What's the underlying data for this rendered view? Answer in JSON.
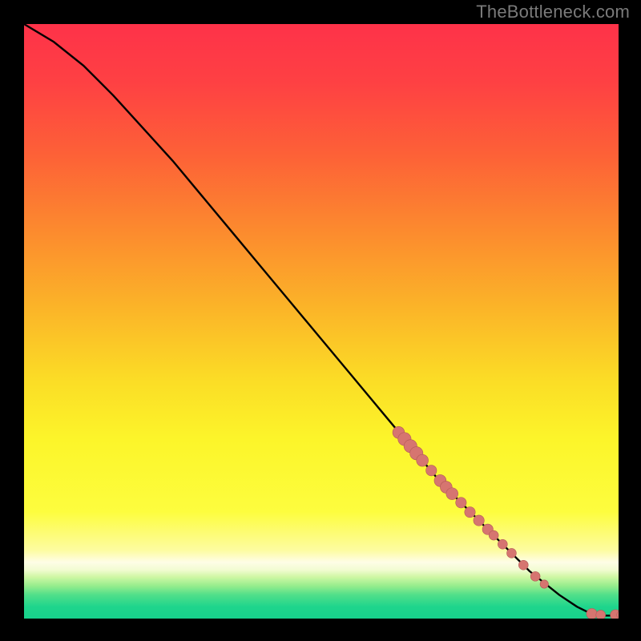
{
  "watermark": "TheBottleneck.com",
  "colors": {
    "curve": "#000000",
    "marker_fill": "#d67570",
    "marker_stroke": "#b25a56",
    "background_stops": [
      {
        "offset": 0.0,
        "color": "#fe3249"
      },
      {
        "offset": 0.1,
        "color": "#fe4143"
      },
      {
        "offset": 0.22,
        "color": "#fd6137"
      },
      {
        "offset": 0.35,
        "color": "#fc8b2e"
      },
      {
        "offset": 0.48,
        "color": "#fbb528"
      },
      {
        "offset": 0.6,
        "color": "#fbdd26"
      },
      {
        "offset": 0.7,
        "color": "#fcf52a"
      },
      {
        "offset": 0.82,
        "color": "#fdfd3e"
      },
      {
        "offset": 0.885,
        "color": "#fdfca0"
      },
      {
        "offset": 0.905,
        "color": "#fefde6"
      },
      {
        "offset": 0.918,
        "color": "#f2fcd2"
      },
      {
        "offset": 0.93,
        "color": "#cff7a4"
      },
      {
        "offset": 0.945,
        "color": "#96ed8d"
      },
      {
        "offset": 0.96,
        "color": "#51df8a"
      },
      {
        "offset": 0.98,
        "color": "#1fd58c"
      },
      {
        "offset": 1.0,
        "color": "#17d18c"
      }
    ]
  },
  "chart_data": {
    "type": "line",
    "title": "",
    "xlabel": "",
    "ylabel": "",
    "xlim": [
      0,
      100
    ],
    "ylim": [
      0,
      100
    ],
    "grid": false,
    "curve": [
      {
        "x": 0,
        "y": 100
      },
      {
        "x": 5,
        "y": 97
      },
      {
        "x": 10,
        "y": 93
      },
      {
        "x": 15,
        "y": 88
      },
      {
        "x": 20,
        "y": 82.5
      },
      {
        "x": 25,
        "y": 77
      },
      {
        "x": 30,
        "y": 71
      },
      {
        "x": 35,
        "y": 65
      },
      {
        "x": 40,
        "y": 59
      },
      {
        "x": 45,
        "y": 53
      },
      {
        "x": 50,
        "y": 47
      },
      {
        "x": 55,
        "y": 41
      },
      {
        "x": 60,
        "y": 35
      },
      {
        "x": 65,
        "y": 29
      },
      {
        "x": 70,
        "y": 23
      },
      {
        "x": 75,
        "y": 18
      },
      {
        "x": 80,
        "y": 13
      },
      {
        "x": 85,
        "y": 8
      },
      {
        "x": 90,
        "y": 4
      },
      {
        "x": 93,
        "y": 2
      },
      {
        "x": 95,
        "y": 1
      },
      {
        "x": 96,
        "y": 0.6
      },
      {
        "x": 98,
        "y": 0.5
      },
      {
        "x": 100,
        "y": 0.5
      }
    ],
    "markers": [
      {
        "x": 63,
        "y": 31.3,
        "r": 1.0
      },
      {
        "x": 64,
        "y": 30.2,
        "r": 1.1
      },
      {
        "x": 65,
        "y": 29.0,
        "r": 1.1
      },
      {
        "x": 66,
        "y": 27.8,
        "r": 1.1
      },
      {
        "x": 67,
        "y": 26.6,
        "r": 1.0
      },
      {
        "x": 68.5,
        "y": 24.9,
        "r": 0.9
      },
      {
        "x": 70,
        "y": 23.2,
        "r": 1.0
      },
      {
        "x": 71,
        "y": 22.1,
        "r": 1.0
      },
      {
        "x": 72,
        "y": 21.0,
        "r": 1.0
      },
      {
        "x": 73.5,
        "y": 19.5,
        "r": 0.9
      },
      {
        "x": 75,
        "y": 17.9,
        "r": 0.9
      },
      {
        "x": 76.5,
        "y": 16.5,
        "r": 0.9
      },
      {
        "x": 78,
        "y": 15.0,
        "r": 0.9
      },
      {
        "x": 79,
        "y": 14.0,
        "r": 0.8
      },
      {
        "x": 80.5,
        "y": 12.5,
        "r": 0.8
      },
      {
        "x": 82,
        "y": 11.0,
        "r": 0.8
      },
      {
        "x": 84,
        "y": 9.0,
        "r": 0.8
      },
      {
        "x": 86,
        "y": 7.1,
        "r": 0.8
      },
      {
        "x": 87.5,
        "y": 5.8,
        "r": 0.7
      },
      {
        "x": 95.5,
        "y": 0.8,
        "r": 0.9
      },
      {
        "x": 97,
        "y": 0.6,
        "r": 0.8
      },
      {
        "x": 99.5,
        "y": 0.6,
        "r": 0.9
      },
      {
        "x": 100.5,
        "y": 0.6,
        "r": 0.8
      }
    ]
  }
}
